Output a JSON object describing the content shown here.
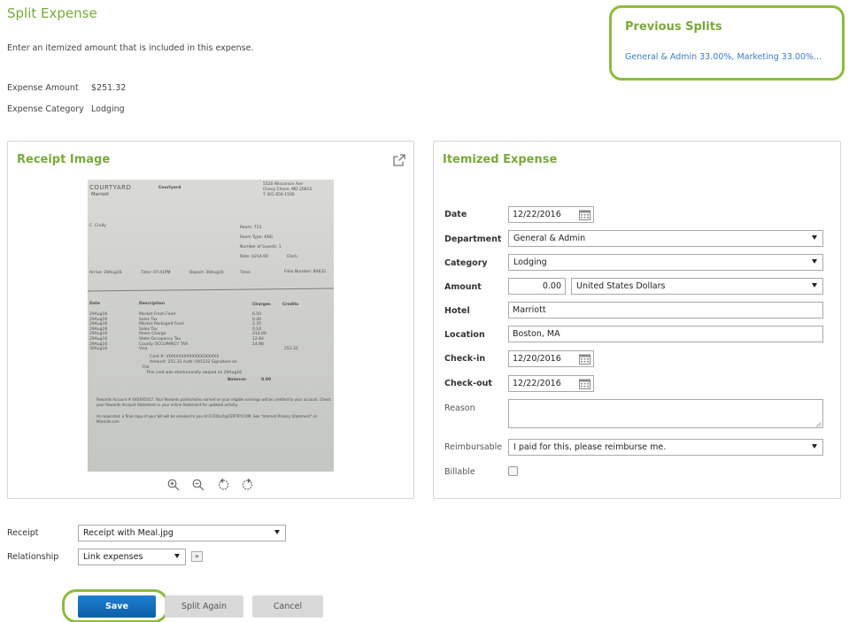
{
  "page": {
    "title": "Split Expense",
    "intro": "Enter an itemized amount that is included in this expense.",
    "expense_amount_label": "Expense Amount",
    "expense_amount_value": "$251.32",
    "expense_category_label": "Expense Category",
    "expense_category_value": "Lodging"
  },
  "previous_splits": {
    "title": "Previous Splits",
    "link": "General & Admin 33.00%, Marketing 33.00%..."
  },
  "receipt_panel": {
    "title": "Receipt Image",
    "open_icon": "external-link-icon",
    "tools": [
      "zoom-in-icon",
      "zoom-out-icon",
      "rotate-left-icon",
      "rotate-right-icon"
    ],
    "receipt": {
      "hotel_brand": "COURTYARD",
      "hotel_sub": "Marriott",
      "header_name": "Courtyard",
      "address1": "5520 Wisconsin Ave",
      "address2": "Chevy Chase, MD 20815",
      "address3": "T 301.656.1500",
      "guest": "C. Crolly",
      "room": "Room: 713",
      "room_type": "Room Type: KNG",
      "guests": "Number of Guests: 1",
      "rate": "Rate: $214.00",
      "clerk": "Clerk:",
      "arrive": "Arrive: 29Aug16",
      "time1": "Time: 07:41PM",
      "depart": "Depart: 30Aug16",
      "time2": "Time:",
      "folio": "Folio Number: 84632",
      "col_date": "Date",
      "col_desc": "Description",
      "col_charges": "Charges",
      "col_credits": "Credits",
      "rows": [
        {
          "date": "29Aug16",
          "desc": "Market Fresh Food",
          "charge": "6.50",
          "credit": ""
        },
        {
          "date": "29Aug16",
          "desc": "Sales Tax",
          "charge": "0.40",
          "credit": ""
        },
        {
          "date": "29Aug16",
          "desc": "Market Packaged Food",
          "charge": "2.35",
          "credit": ""
        },
        {
          "date": "29Aug16",
          "desc": "Sales Tax",
          "charge": "0.14",
          "credit": ""
        },
        {
          "date": "29Aug16",
          "desc": "Room Charge",
          "charge": "214.00",
          "credit": ""
        },
        {
          "date": "29Aug16",
          "desc": "State Occupancy Tax",
          "charge": "12.84",
          "credit": ""
        },
        {
          "date": "29Aug16",
          "desc": "County OCCUPANCY TAX",
          "charge": "14.98",
          "credit": ""
        },
        {
          "date": "30Aug16",
          "desc": "Visa",
          "charge": "",
          "credit": "251.32"
        }
      ],
      "card": "Card #: VIXXXXXXXXXXXX5XXXXX",
      "amount_line": "Amount: 251.32  Auth: 045132  Signature on",
      "file": "File",
      "swiped": "This card was electronically swiped on 29Aug16",
      "balance_label": "Balance:",
      "balance_value": "0.00",
      "rewards": "Rewards Account # XXXXX5417.  Your Rewards points/miles earned on your eligible earnings will be credited to your account. Check your Rewards Account Statement or your online Statement for updated activity.",
      "footer": "As requested, a final copy of your bill will be emailed to you at CCROLLY@CERTIFY.COM. See \"Internet Privacy Statement\" on Marriott.com"
    }
  },
  "itemized": {
    "title": "Itemized Expense",
    "date_label": "Date",
    "date_value": "12/22/2016",
    "department_label": "Department",
    "department_value": "General & Admin",
    "category_label": "Category",
    "category_value": "Lodging",
    "amount_label": "Amount",
    "amount_value": "0.00",
    "currency_value": "United States Dollars",
    "hotel_label": "Hotel",
    "hotel_value": "Marriott",
    "location_label": "Location",
    "location_value": "Boston, MA",
    "checkin_label": "Check-in",
    "checkin_value": "12/20/2016",
    "checkout_label": "Check-out",
    "checkout_value": "12/22/2016",
    "reason_label": "Reason",
    "reimbursable_label": "Reimbursable",
    "reimbursable_value": "I paid for this, please reimburse me.",
    "billable_label": "Billable"
  },
  "bottom": {
    "receipt_label": "Receipt",
    "receipt_value": "Receipt with Meal.jpg",
    "relationship_label": "Relationship",
    "relationship_value": "Link expenses",
    "forward_glyph": "»"
  },
  "actions": {
    "save": "Save",
    "split_again": "Split Again",
    "cancel": "Cancel"
  },
  "colors": {
    "accent_green": "#7aa83c",
    "highlight_ring": "#8dbb3c",
    "link_blue": "#3a7cc4",
    "primary_button": "#1670bd"
  }
}
